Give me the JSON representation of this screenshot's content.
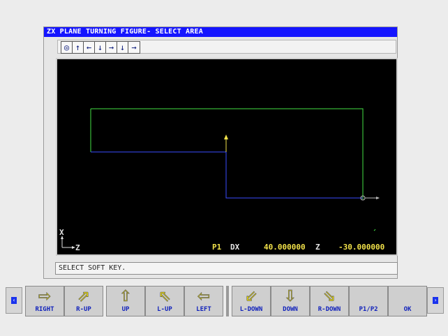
{
  "window": {
    "title": "ZX PLANE TURNING FIGURE- SELECT AREA"
  },
  "toolbar": {
    "icons": [
      {
        "name": "target-icon",
        "glyph": "◎"
      },
      {
        "name": "arrow-up-icon",
        "glyph": "↑"
      },
      {
        "name": "arrow-left-icon",
        "glyph": "←"
      },
      {
        "name": "arrow-down-icon",
        "glyph": "↓"
      },
      {
        "name": "arrow-right-icon",
        "glyph": "→"
      },
      {
        "name": "arrow-down-icon",
        "glyph": "↓"
      },
      {
        "name": "arrow-right-icon",
        "glyph": "→"
      }
    ]
  },
  "graphics": {
    "axis_x_label": "X",
    "axis_z_label": "Z",
    "readout": {
      "point": "P1",
      "dx_label": "DX",
      "dx_value": "40.000000",
      "z_label": "Z",
      "z_value": "-30.000000"
    },
    "colors": {
      "outline": "#44e044",
      "selected": "#3a4cff",
      "cursor": "#f2e24a",
      "axis": "#e0e0e0"
    }
  },
  "status": {
    "message": "SELECT SOFT KEY."
  },
  "softkeys": {
    "prev_icon": "chevron-left-icon",
    "next_icon": "chevron-right-icon",
    "keys": [
      {
        "label": "RIGHT",
        "icon": "arrow-right-icon",
        "glyph": "⇨"
      },
      {
        "label": "R-UP",
        "icon": "arrow-up-right-icon",
        "glyph": "⇗"
      },
      {
        "label": "UP",
        "icon": "arrow-up-icon",
        "glyph": "⇧"
      },
      {
        "label": "L-UP",
        "icon": "arrow-up-left-icon",
        "glyph": "⇖"
      },
      {
        "label": "LEFT",
        "icon": "arrow-left-icon",
        "glyph": "⇦"
      },
      {
        "label": "L-DOWN",
        "icon": "arrow-down-left-icon",
        "glyph": "⇙"
      },
      {
        "label": "DOWN",
        "icon": "arrow-down-icon",
        "glyph": "⇩"
      },
      {
        "label": "R-DOWN",
        "icon": "arrow-down-right-icon",
        "glyph": "⇘"
      },
      {
        "label": "P1/P2",
        "icon": "",
        "glyph": ""
      },
      {
        "label": "OK",
        "icon": "",
        "glyph": ""
      }
    ]
  }
}
